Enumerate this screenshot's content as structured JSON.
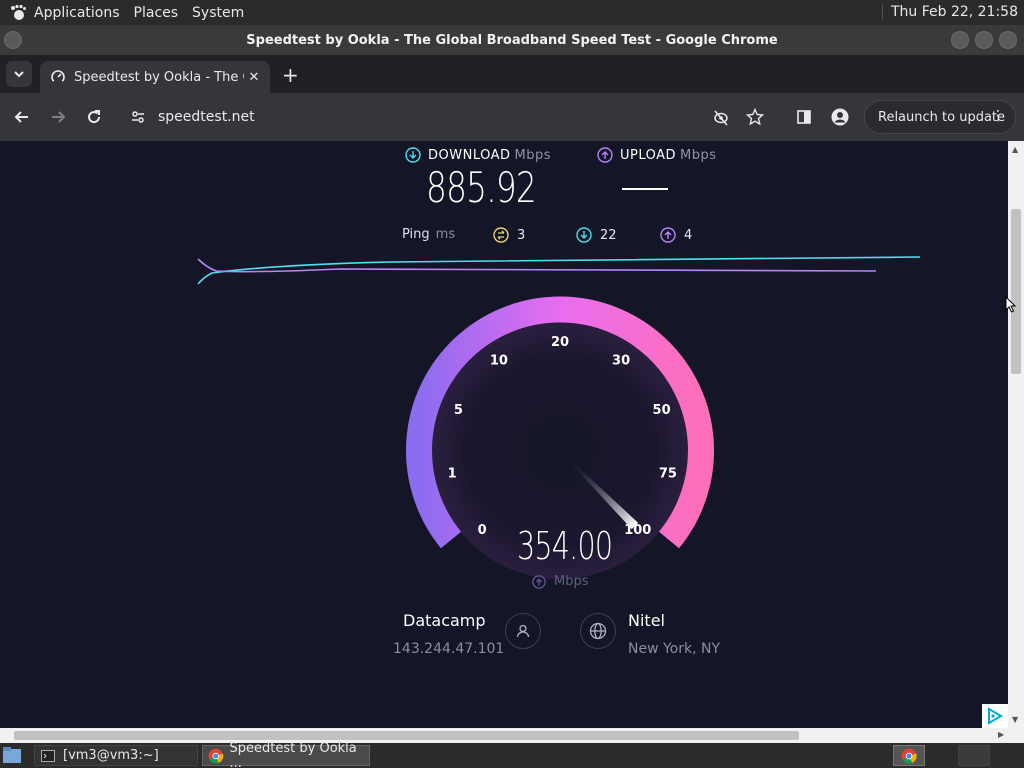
{
  "panel": {
    "menus": [
      "Applications",
      "Places",
      "System"
    ],
    "clock": "Thu Feb 22, 21:58"
  },
  "window": {
    "title": "Speedtest by Ookla - The Global Broadband Speed Test - Google Chrome"
  },
  "tabs": [
    {
      "label": "Speedtest by Ookla - The Global Broadband Speed Test",
      "close": "✕"
    }
  ],
  "toolbar": {
    "url": "speedtest.net",
    "relaunch_label": "Relaunch to update",
    "menu_glyph": "⋮"
  },
  "speedtest": {
    "download": {
      "label": "DOWNLOAD",
      "unit": "Mbps",
      "value": "885.92"
    },
    "upload": {
      "label": "UPLOAD",
      "unit": "Mbps",
      "value": "——"
    },
    "ping": {
      "label": "Ping",
      "unit": "ms",
      "idle": "3",
      "down": "22",
      "up": "4"
    },
    "gauge": {
      "value": "354.00",
      "unit": "Mbps",
      "ticks": [
        "0",
        "1",
        "5",
        "10",
        "20",
        "30",
        "50",
        "75",
        "100"
      ],
      "needle_value": 354
    },
    "host": {
      "name": "Datacamp",
      "ip": "143.244.47.101"
    },
    "server": {
      "name": "Nitel",
      "location": "New York, NY"
    },
    "colors": {
      "download": "#4ce0ef",
      "upload": "#b586f8",
      "gauge_start": "#8c6cf0",
      "gauge_end": "#ff6fb8"
    }
  },
  "taskbar": {
    "items": [
      {
        "label": "[vm3@vm3:~]"
      },
      {
        "label": "Speedtest by Ookla ..."
      }
    ]
  }
}
